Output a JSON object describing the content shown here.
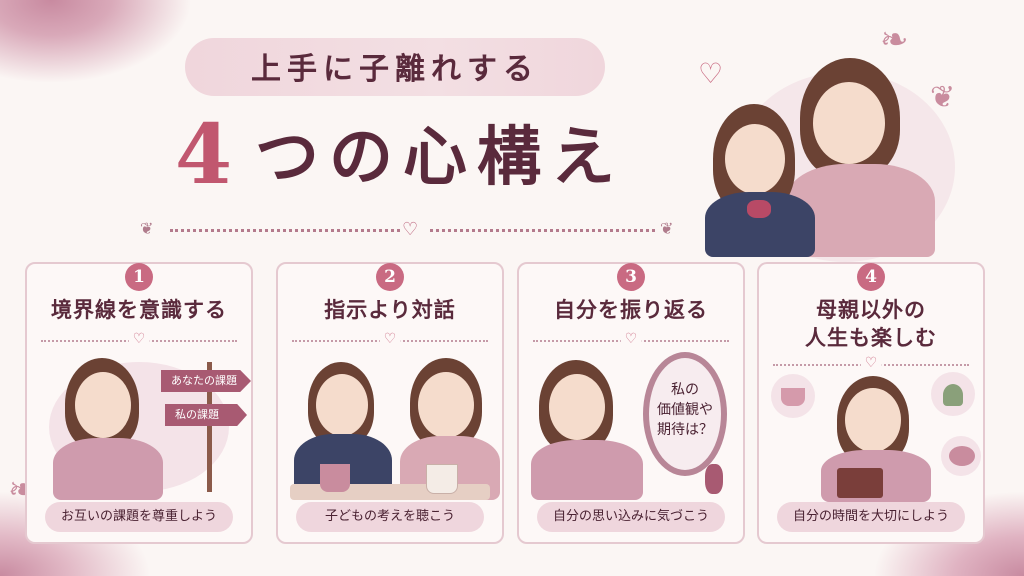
{
  "header": {
    "subtitle": "上手に子離れする",
    "title_number": "4",
    "title_text": "つの心構え"
  },
  "cards": [
    {
      "number": "1",
      "title_lines": [
        "境界線を意識する"
      ],
      "caption": "お互いの課題を尊重しよう",
      "signs": [
        "あなたの課題",
        "私の課題"
      ]
    },
    {
      "number": "2",
      "title_lines": [
        "指示より対話"
      ],
      "caption": "子どもの考えを聴こう"
    },
    {
      "number": "3",
      "title_lines": [
        "自分を振り返る"
      ],
      "caption": "自分の思い込みに気づこう",
      "mirror_lines": [
        "私の",
        "価値観や",
        "期待は？"
      ]
    },
    {
      "number": "4",
      "title_lines": [
        "母親以外の",
        "人生も楽しむ"
      ],
      "caption": "自分の時間を大切にしよう"
    }
  ],
  "colors": {
    "accent": "#c1576f",
    "text": "#5a2a3c",
    "pill": "#efd6dd",
    "badge": "#c96a82"
  }
}
